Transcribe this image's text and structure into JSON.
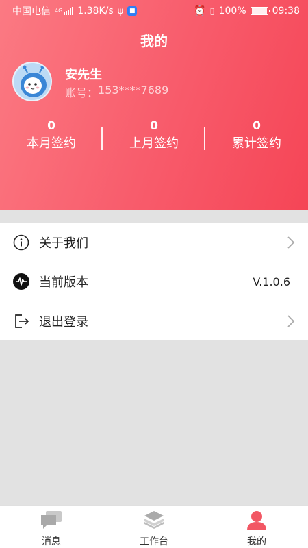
{
  "status_bar": {
    "carrier": "中国电信",
    "net_type": "4G",
    "speed": "1.38K/s",
    "battery": "100%",
    "time": "09:38"
  },
  "header": {
    "title": "我的"
  },
  "user": {
    "name": "安先生",
    "account_label": "账号：",
    "account_value": "153****7689"
  },
  "stats": [
    {
      "value": "0",
      "label": "本月签约"
    },
    {
      "value": "0",
      "label": "上月签约"
    },
    {
      "value": "0",
      "label": "累计签约"
    }
  ],
  "menu": {
    "about": {
      "label": "关于我们",
      "icon": "info-icon"
    },
    "version": {
      "label": "当前版本",
      "value": "V.1.0.6",
      "icon": "pulse-icon"
    },
    "logout": {
      "label": "退出登录",
      "icon": "logout-icon"
    }
  },
  "tabbar": [
    {
      "label": "消息",
      "icon": "chat-icon"
    },
    {
      "label": "工作台",
      "icon": "layers-icon"
    },
    {
      "label": "我的",
      "icon": "user-icon",
      "active": true
    }
  ],
  "colors": {
    "header_start": "#fb7a83",
    "header_end": "#f54556",
    "active_tab_icon": "#f25764",
    "background": "#e2e2e2"
  }
}
